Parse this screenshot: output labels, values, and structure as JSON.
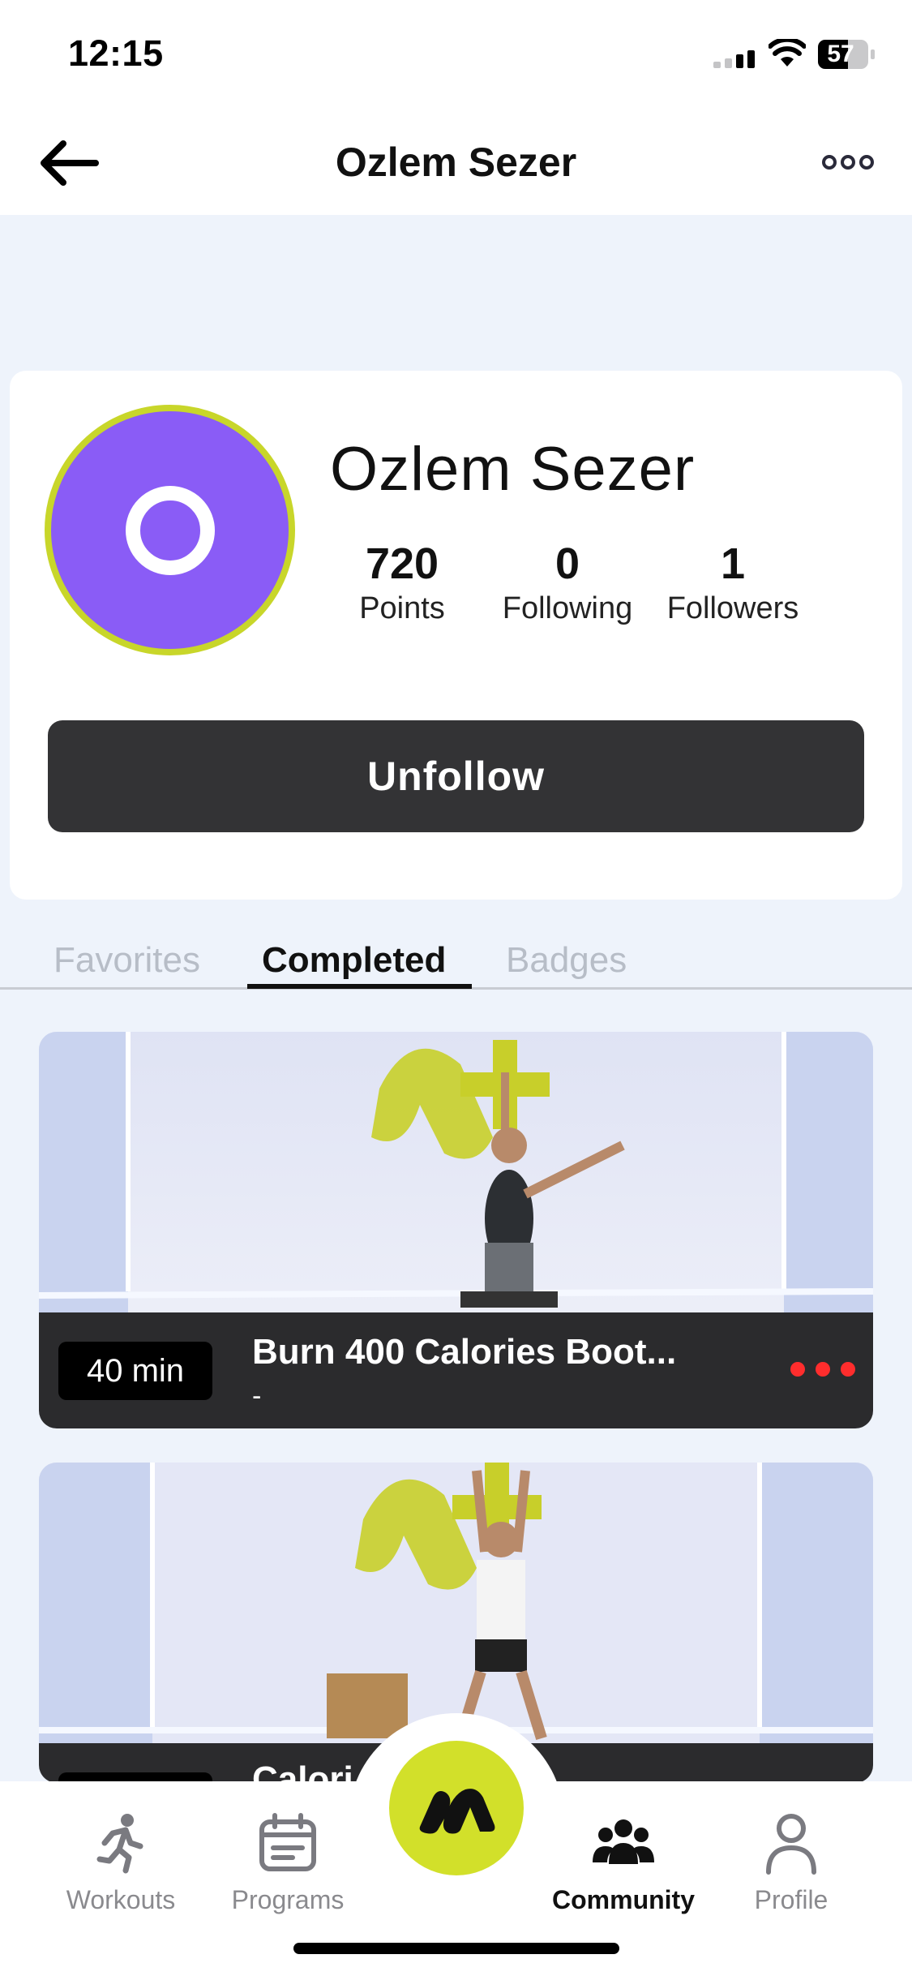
{
  "status_bar": {
    "time": "12:15",
    "battery": "57"
  },
  "nav": {
    "title": "Ozlem Sezer",
    "back_icon": "arrow-left-icon",
    "more_icon": "more-dots-icon"
  },
  "profile": {
    "name": "Ozlem Sezer",
    "avatar_letter_shape": "O",
    "avatar_color": "#8a5cf6",
    "avatar_ring_color": "#c8d62a",
    "stats": [
      {
        "value": "720",
        "label": "Points"
      },
      {
        "value": "0",
        "label": "Following"
      },
      {
        "value": "1",
        "label": "Followers"
      }
    ],
    "unfollow_label": "Unfollow"
  },
  "tabs": [
    {
      "label": "Favorites",
      "active": false
    },
    {
      "label": "Completed",
      "active": true
    },
    {
      "label": "Badges",
      "active": false
    }
  ],
  "workouts": [
    {
      "duration": "40 min",
      "title": "Burn 400 Calories Boot...",
      "subtitle": "-"
    },
    {
      "title": "Calori"
    }
  ],
  "bottom_nav": {
    "items": [
      {
        "label": "Workouts",
        "icon": "running-figure-icon",
        "active": false
      },
      {
        "label": "Programs",
        "icon": "calendar-icon",
        "active": false
      },
      {
        "label": "Community",
        "icon": "group-icon",
        "active": true
      },
      {
        "label": "Profile",
        "icon": "person-icon",
        "active": false
      }
    ],
    "center_icon": "brand-logo-icon",
    "accent_color": "#d2e02a"
  }
}
